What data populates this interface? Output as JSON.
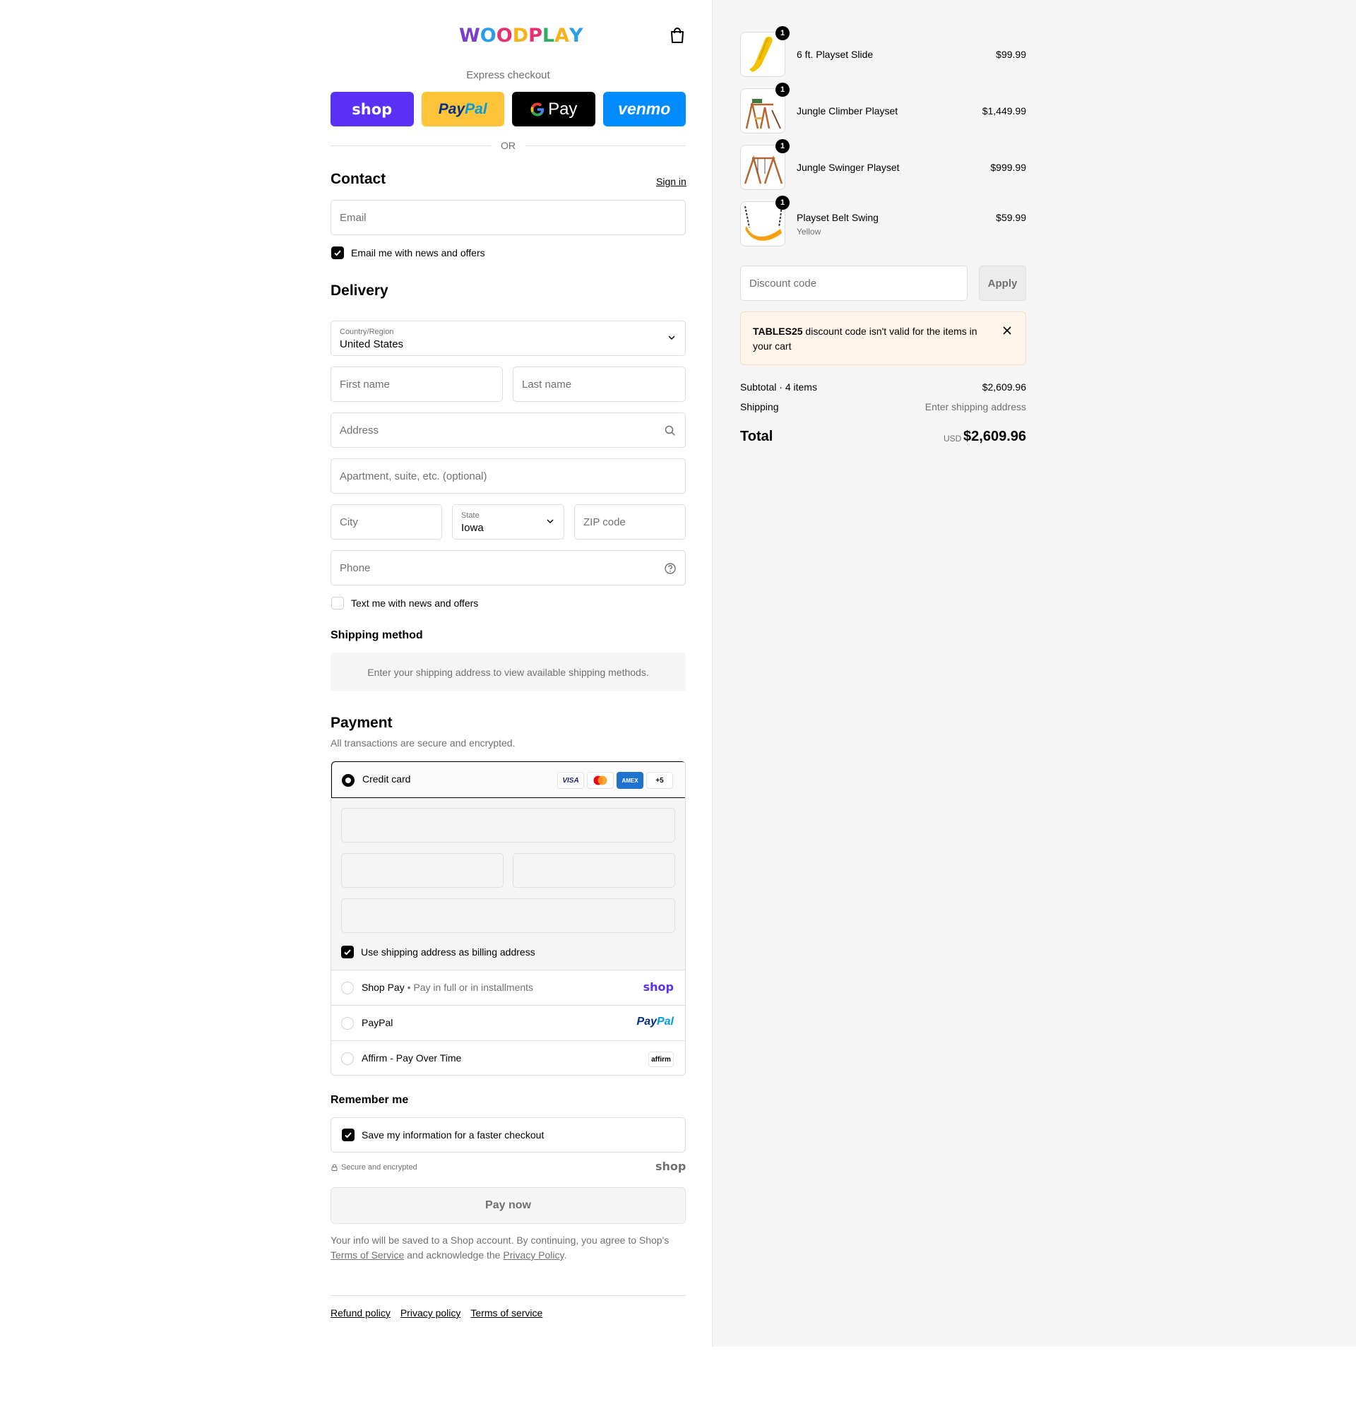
{
  "brand": {
    "logo_letters": [
      "W",
      "O",
      "O",
      "D",
      "P",
      "L",
      "A",
      "Y"
    ],
    "logo_colors": [
      "#7a3fc6",
      "#2a9de8",
      "#e8306e",
      "#f4b31a",
      "#e8306e",
      "#2fae63",
      "#f4b31a",
      "#2a9de8"
    ]
  },
  "header": {
    "cart_icon": "shopping-bag-icon"
  },
  "express": {
    "label": "Express checkout",
    "shop_label": "shop",
    "paypal_label_1": "Pay",
    "paypal_label_2": "Pal",
    "gpay_label": "Pay",
    "venmo_label": "venmo",
    "or_label": "OR"
  },
  "contact": {
    "title": "Contact",
    "sign_in": "Sign in",
    "email_placeholder": "Email",
    "news_checkbox": "Email me with news and offers",
    "news_checked": true
  },
  "delivery": {
    "title": "Delivery",
    "country_label": "Country/Region",
    "country_value": "United States",
    "first_name_placeholder": "First name",
    "last_name_placeholder": "Last name",
    "address_placeholder": "Address",
    "apartment_placeholder": "Apartment, suite, etc. (optional)",
    "city_placeholder": "City",
    "state_label": "State",
    "state_value": "Iowa",
    "zip_placeholder": "ZIP code",
    "phone_placeholder": "Phone",
    "text_checkbox": "Text me with news and offers",
    "text_checked": false
  },
  "shipping_method": {
    "title": "Shipping method",
    "note": "Enter your shipping address to view available shipping methods."
  },
  "payment": {
    "title": "Payment",
    "subtitle": "All transactions are secure and encrypted.",
    "credit_card_label": "Credit card",
    "card_brands": [
      "VISA",
      "Mastercard",
      "AMEX",
      "+5"
    ],
    "billing_checkbox": "Use shipping address as billing address",
    "billing_checked": true,
    "shop_pay_label": "Shop Pay",
    "shop_pay_detail": "Pay in full or in installments",
    "shop_pay_brand": "shop",
    "paypal_label": "PayPal",
    "paypal_brand_1": "Pay",
    "paypal_brand_2": "Pal",
    "affirm_label": "Affirm - Pay Over Time",
    "affirm_brand": "affirm"
  },
  "remember": {
    "title": "Remember me",
    "save_checkbox": "Save my information for a faster checkout",
    "save_checked": true,
    "secure_note": "Secure and encrypted",
    "shop_brand": "shop"
  },
  "pay_now": "Pay now",
  "legal": {
    "line_1": "Your info will be saved to a Shop account. By continuing, you agree to Shop's",
    "terms_link": "Terms of Service",
    "middle": "and acknowledge the",
    "privacy_link": "Privacy Policy",
    "end": "."
  },
  "footer": {
    "refund": "Refund policy",
    "privacy": "Privacy policy",
    "terms": "Terms of service"
  },
  "cart": {
    "items": [
      {
        "name": "6 ft. Playset Slide",
        "qty": "1",
        "price": "$99.99",
        "variant": ""
      },
      {
        "name": "Jungle Climber Playset",
        "qty": "1",
        "price": "$1,449.99",
        "variant": ""
      },
      {
        "name": "Jungle Swinger Playset",
        "qty": "1",
        "price": "$999.99",
        "variant": ""
      },
      {
        "name": "Playset Belt Swing",
        "qty": "1",
        "price": "$59.99",
        "variant": "Yellow"
      }
    ],
    "discount_placeholder": "Discount code",
    "apply_label": "Apply",
    "warning_code": "TABLES25",
    "warning_text": " discount code isn't valid for the items in your cart",
    "subtotal_label": "Subtotal · 4 items",
    "subtotal_value": "$2,609.96",
    "shipping_label": "Shipping",
    "shipping_value": "Enter shipping address",
    "total_label": "Total",
    "total_currency": "USD",
    "total_value": "$2,609.96"
  },
  "colors": {
    "shop_purple": "#5a31f4",
    "paypal_yellow": "#ffc439",
    "venmo_blue": "#008cff",
    "warning_bg": "#fff5eb"
  }
}
